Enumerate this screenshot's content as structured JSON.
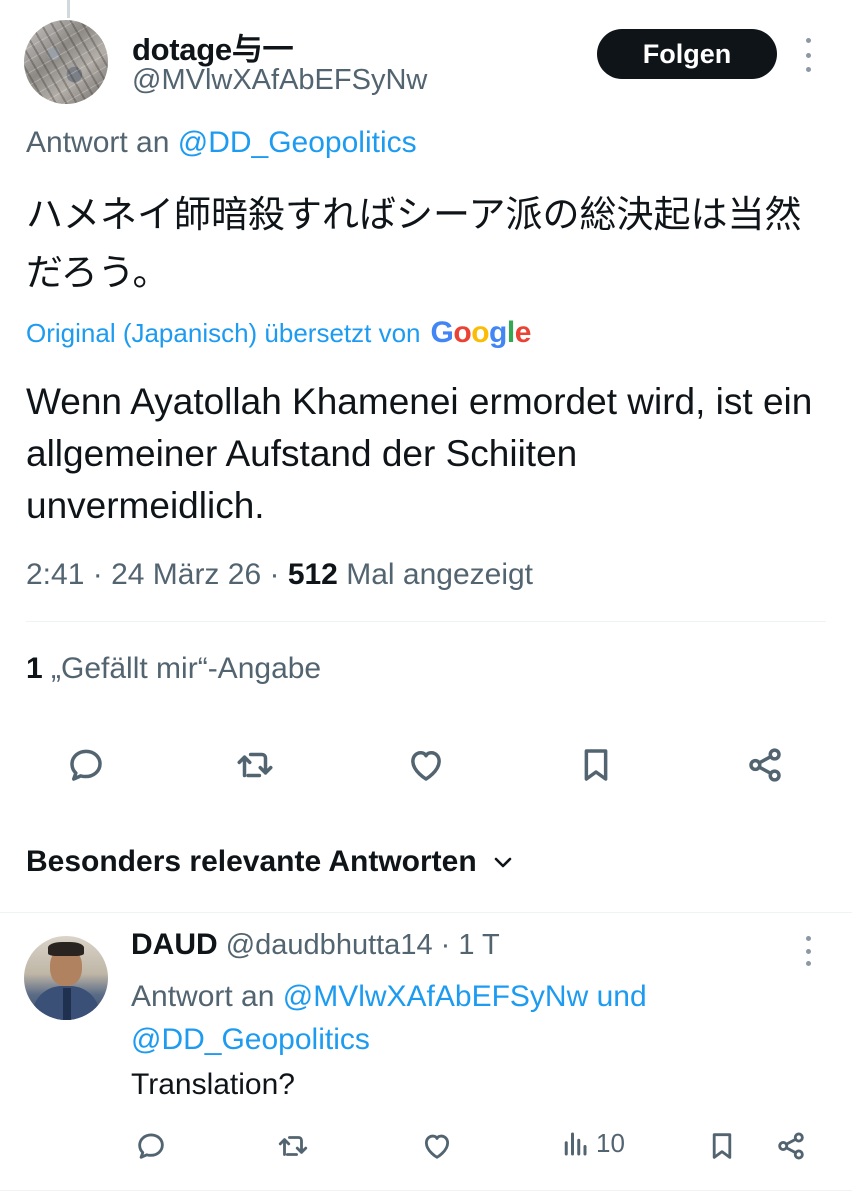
{
  "tweet": {
    "author_name": "dotage与一",
    "author_handle": "@MVlwXAfAbEFSyNw",
    "follow_label": "Folgen",
    "reply_prefix": "Antwort an ",
    "reply_to": "@DD_Geopolitics",
    "original_text": "ハメネイ師暗殺すればシーア派の総決起は当然だろう。",
    "translated_label": "Original (Japanisch) übersetzt von",
    "translator": "Google",
    "translation_text": "Wenn Ayatollah Khamenei ermordet wird, ist ein allgemeiner Aufstand der Schiiten unvermeidlich.",
    "time": "2:41",
    "date": "24 März 26",
    "views_count": "512",
    "views_label": "Mal angezeigt",
    "likes_count": "1",
    "likes_label": "„Gefällt mir“-Angabe"
  },
  "icons": {
    "reply": "comment-icon",
    "retweet": "retweet-icon",
    "like": "heart-icon",
    "bookmark": "bookmark-icon",
    "share": "share-icon"
  },
  "sort": {
    "label": "Besonders relevante Antworten"
  },
  "reply": {
    "name": "DAUD",
    "handle": "@daudbhutta14",
    "time": "1 T",
    "reply_prefix": "Antwort an ",
    "reply_to_1": "@MVlwXAfAbEFSyNw",
    "conjunction": " und ",
    "reply_to_2": "@DD_Geopolitics",
    "text": "Translation?",
    "views": "10"
  },
  "colors": {
    "accent": "#1d9bf0",
    "text": "#0f1419",
    "muted": "#536471",
    "follow_bg": "#0f1419"
  }
}
